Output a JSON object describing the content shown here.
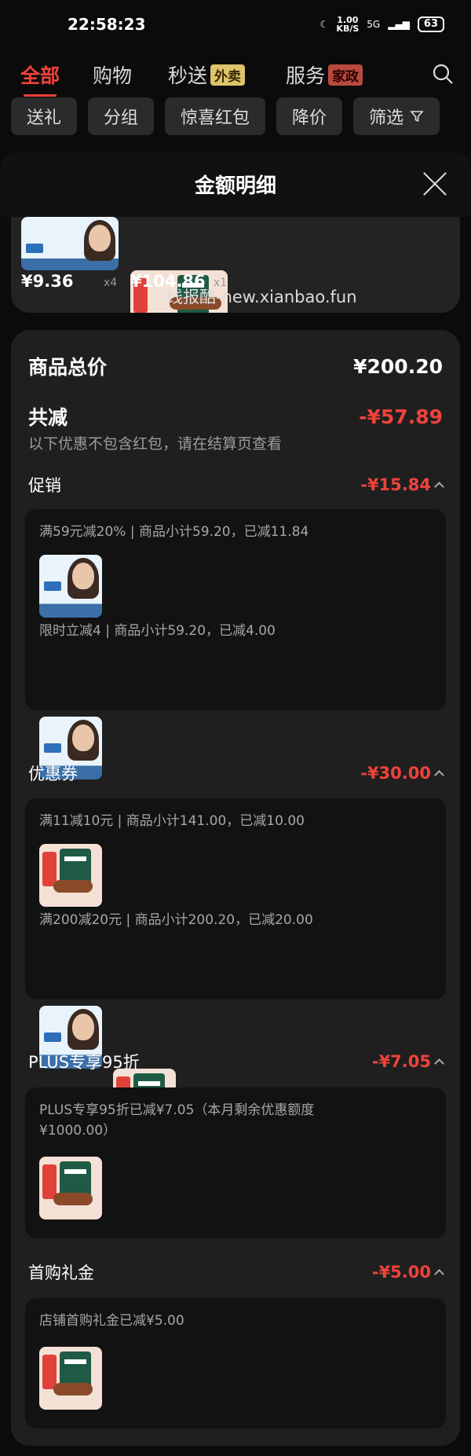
{
  "status": {
    "time": "22:58:23",
    "speed": "1.00",
    "speed_unit": "KB/S",
    "network": "5G",
    "battery": "63"
  },
  "top_tabs": {
    "all": "全部",
    "shopping": "购物",
    "express": "秒送",
    "express_badge": "外卖",
    "service": "服务",
    "service_badge": "家政"
  },
  "filters": [
    "送礼",
    "分组",
    "惊喜红包",
    "降价",
    "筛选"
  ],
  "sheet": {
    "title": "金额明细"
  },
  "cart_items": [
    {
      "price": "¥9.36",
      "qty": "x4"
    },
    {
      "price": "¥104.86",
      "qty": "x1"
    }
  ],
  "watermark": "线报酷-new.xianbao.fun",
  "summary": {
    "total_label": "商品总价",
    "total_value": "¥200.20",
    "discount_label": "共减",
    "discount_value": "-¥57.89",
    "note": "以下优惠不包含红包，请在结算页查看"
  },
  "sections": {
    "promo": {
      "title": "促销",
      "value": "-¥15.84",
      "lines": [
        "满59元减20% | 商品小计59.20，已减11.84",
        "限时立减4 | 商品小计59.20，已减4.00"
      ]
    },
    "coupon": {
      "title": "优惠券",
      "value": "-¥30.00",
      "lines": [
        "满11减10元 | 商品小计141.00，已减10.00",
        "满200减20元 | 商品小计200.20，已减20.00"
      ]
    },
    "plus": {
      "title": "PLUS专享95折",
      "value": "-¥7.05",
      "line1": "PLUS专享95折已减¥7.05（本月剩余优惠额度",
      "line2": "¥1000.00）"
    },
    "first": {
      "title": "首购礼金",
      "value": "-¥5.00",
      "line": "店铺首购礼金已减¥5.00"
    }
  },
  "colors": {
    "accent": "#f0423a",
    "background": "#0b0b0b",
    "panel": "#1f1f1f"
  }
}
